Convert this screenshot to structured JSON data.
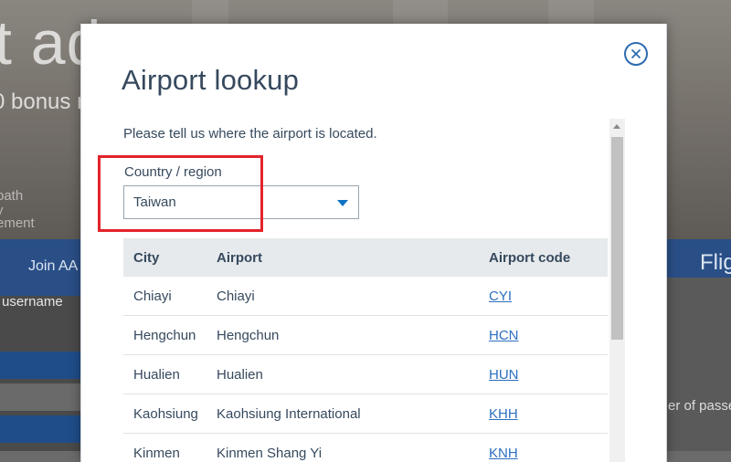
{
  "background": {
    "hero_text": "t ad",
    "bonus_text": "0 bonus m",
    "small_text_1": "path",
    "small_text_2": "y",
    "small_text_3": "ement",
    "join_text": "Join AA",
    "flight_text": "Flig",
    "username_label": "username",
    "passengers_label": "er of passe"
  },
  "modal": {
    "title": "Airport lookup",
    "instruction": "Please tell us where the airport is located.",
    "country_label": "Country / region",
    "country_value": "Taiwan",
    "table": {
      "headers": [
        "City",
        "Airport",
        "Airport code"
      ],
      "rows": [
        {
          "city": "Chiayi",
          "airport": "Chiayi",
          "code": "CYI"
        },
        {
          "city": "Hengchun",
          "airport": "Hengchun",
          "code": "HCN"
        },
        {
          "city": "Hualien",
          "airport": "Hualien",
          "code": "HUN"
        },
        {
          "city": "Kaohsiung",
          "airport": "Kaohsiung International",
          "code": "KHH"
        },
        {
          "city": "Kinmen",
          "airport": "Kinmen Shang Yi",
          "code": "KNH"
        }
      ]
    }
  },
  "colors": {
    "accent": "#2d6bb0",
    "highlight": "#e3232a",
    "text": "#36495d",
    "link": "#2c6fc0"
  }
}
